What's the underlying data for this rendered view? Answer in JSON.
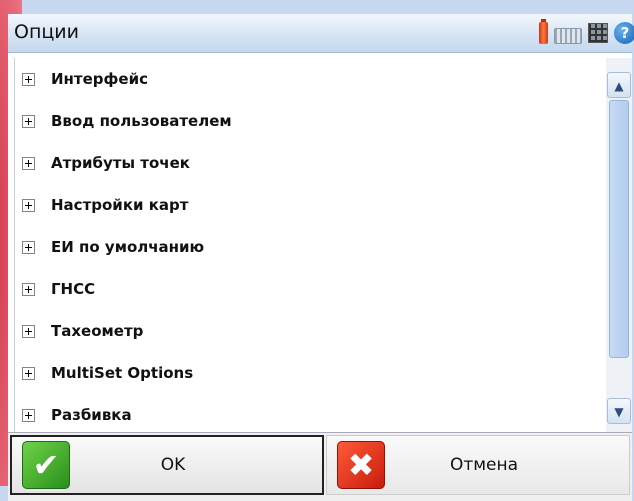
{
  "window": {
    "title": "Опции"
  },
  "status_icons": [
    {
      "name": "battery-icon"
    },
    {
      "name": "keyboard-icon"
    },
    {
      "name": "grid-icon"
    },
    {
      "name": "help-icon",
      "glyph": "?"
    }
  ],
  "tree": {
    "items": [
      {
        "label": "Интерфейс",
        "expander": "+"
      },
      {
        "label": "Ввод пользователем",
        "expander": "+"
      },
      {
        "label": "Атрибуты точек",
        "expander": "+"
      },
      {
        "label": "Настройки карт",
        "expander": "+"
      },
      {
        "label": "ЕИ по умолчанию",
        "expander": "+"
      },
      {
        "label": "ГНСС",
        "expander": "+"
      },
      {
        "label": "Тахеометр",
        "expander": "+"
      },
      {
        "label": "MultiSet Options",
        "expander": "+"
      },
      {
        "label": "Разбивка",
        "expander": "+"
      }
    ]
  },
  "scrollbar": {
    "up_glyph": "▲",
    "down_glyph": "▼"
  },
  "buttons": {
    "ok": {
      "label": "OK",
      "icon_glyph": "✔"
    },
    "cancel": {
      "label": "Отмена",
      "icon_glyph": "✖"
    }
  },
  "colors": {
    "accent": "#d0344a",
    "titlebar": "#d6e4f4",
    "ok": "#2a8f1c",
    "cancel": "#c91c0c"
  }
}
